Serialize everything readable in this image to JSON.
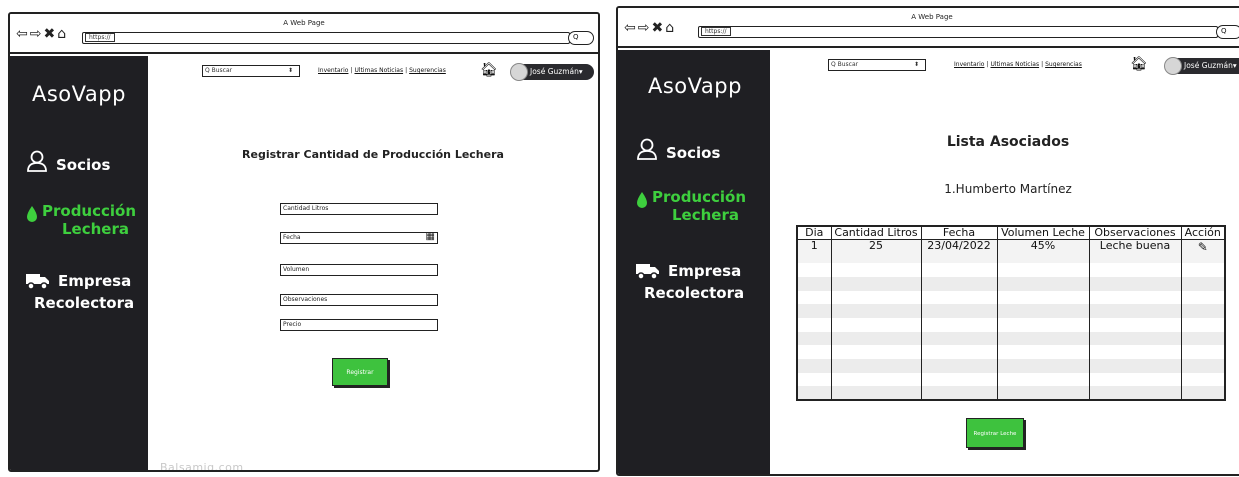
{
  "window": {
    "title": "A Web Page",
    "url": "https://",
    "nav_arrows": [
      "⇦",
      "⇨",
      "✖",
      "⌂"
    ],
    "search_pill_glyph": "Q"
  },
  "sidebar": {
    "brand": "AsoVapp",
    "items": [
      {
        "label": "Socios",
        "icon": "user-outline-icon",
        "active": false
      },
      {
        "label_line1": "Producción",
        "label_line2": "Lechera",
        "icon": "milk-drop-icon",
        "active": true
      },
      {
        "label_line1": "Empresa",
        "label_line2": "Recolectora",
        "icon": "truck-icon",
        "active": false
      }
    ]
  },
  "topnav": {
    "search_placeholder": "Q Buscar",
    "links": [
      "Inventario",
      "Ultimas Noticias",
      "Sugerencias"
    ],
    "user_name": "José Guzmán▾"
  },
  "left_screen": {
    "form_title": "Registrar Cantidad de Producción Lechera",
    "fields": [
      "Cantidad Litros",
      "Fecha",
      "Volumen",
      "Observaciones",
      "Precio"
    ],
    "submit_label": "Registrar",
    "footer_mark": "Balsamiq.com"
  },
  "right_screen": {
    "title": "Lista Asociados",
    "associate": "1.Humberto Martínez",
    "table": {
      "columns": [
        "Dia",
        "Cantidad Litros",
        "Fecha",
        "Volumen Leche",
        "Observaciones",
        "Acción"
      ],
      "rows": [
        {
          "dia": "1",
          "litros": "25",
          "fecha": "23/04/2022",
          "volumen": "45%",
          "observaciones": "Leche buena",
          "accion_icon": "edit-icon"
        }
      ],
      "empty_rows": 10
    },
    "submit_label": "Registrar Leche"
  },
  "colors": {
    "sidebar_bg": "#1f1f23",
    "accent_green": "#3ecf3e",
    "button_green": "#3ec23e"
  }
}
